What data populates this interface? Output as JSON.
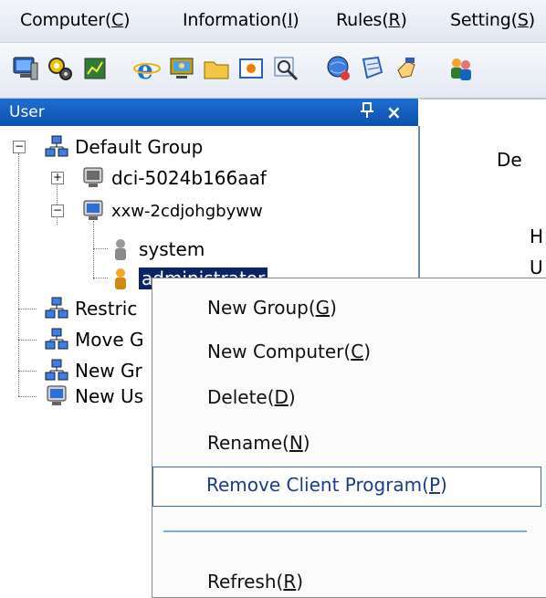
{
  "menubar": {
    "items": [
      {
        "label": "Computer(",
        "hotkey": "C",
        "suffix": ")"
      },
      {
        "label": "Information(",
        "hotkey": "I",
        "suffix": ")"
      },
      {
        "label": "Rules(",
        "hotkey": "R",
        "suffix": ")"
      },
      {
        "label": "Setting(",
        "hotkey": "S",
        "suffix": ")"
      }
    ]
  },
  "toolbar": {
    "icons": [
      "computer-icon",
      "settings-gears-icon",
      "chart-icon",
      "internet-explorer-icon",
      "monitor-user-icon",
      "folder-icon",
      "screenshot-icon",
      "search-icon",
      "network-icon",
      "policy-icon",
      "hand-icon",
      "users-icon"
    ]
  },
  "panel": {
    "title": "User",
    "pin_glyph": "ꟷ",
    "close_glyph": "×"
  },
  "tree": {
    "root": "Default Group",
    "children": [
      {
        "label": "dci-5024b166aaf"
      },
      {
        "label": "xxw-2cdjohgbyww"
      }
    ],
    "users": [
      {
        "label": "system"
      },
      {
        "label": "administrator"
      }
    ],
    "groups": [
      {
        "label": "Restric"
      },
      {
        "label": "Move G"
      },
      {
        "label": "New Gr"
      },
      {
        "label": "New Us"
      }
    ]
  },
  "right_pane": {
    "labels": [
      "De",
      "H",
      "U"
    ]
  },
  "context_menu": {
    "items": [
      {
        "label": "New Group(",
        "hotkey": "G",
        "suffix": ")"
      },
      {
        "label": "New Computer(",
        "hotkey": "C",
        "suffix": ")"
      },
      {
        "label": "Delete(",
        "hotkey": "D",
        "suffix": ")"
      },
      {
        "label": "Rename(",
        "hotkey": "N",
        "suffix": ")"
      },
      {
        "label": "Remove Client Program(",
        "hotkey": "P",
        "suffix": ")"
      },
      {
        "label": "Refresh(",
        "hotkey": "R",
        "suffix": ")"
      }
    ]
  },
  "colors": {
    "panel_header": "#0b4fb0",
    "selection": "#0a246a",
    "menu_highlight_border": "#3a6ea5"
  }
}
